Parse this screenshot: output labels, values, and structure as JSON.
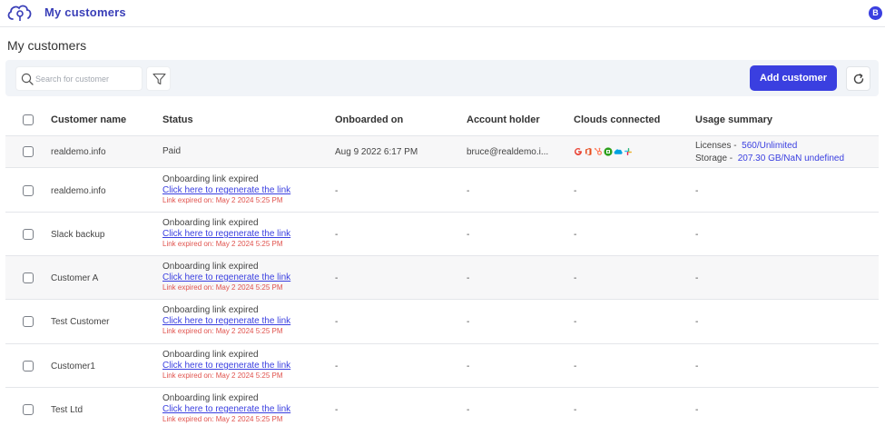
{
  "header": {
    "app_title": "My customers",
    "avatar_initial": "B"
  },
  "page_title": "My customers",
  "toolbar": {
    "search_placeholder": "Search for customer",
    "add_label": "Add customer"
  },
  "columns": [
    "Customer name",
    "Status",
    "Onboarded on",
    "Account holder",
    "Clouds connected",
    "Usage summary"
  ],
  "first_row": {
    "name": "realdemo.info",
    "status": "Paid",
    "onboarded_on": "Aug 9 2022 6:17 PM",
    "account_holder": "bruce@realdemo.i...",
    "clouds": [
      "google-icon",
      "office365-icon",
      "hubspot-icon",
      "quickbooks-icon",
      "salesforce-icon",
      "slack-icon"
    ],
    "licenses_label": "Licenses -",
    "licenses_value": "560/Unlimited",
    "storage_label": "Storage -",
    "storage_value": "207.30 GB/NaN undefined"
  },
  "pending_rows": [
    {
      "name": "realdemo.info",
      "status": "Onboarding link expired",
      "link": "Click here to regenerate the link",
      "expired": "Link expired on: May 2 2024 5:25 PM",
      "onboarded_on": "-",
      "account_holder": "-",
      "clouds": "-",
      "usage": "-"
    },
    {
      "name": "Slack backup",
      "status": "Onboarding link expired",
      "link": "Click here to regenerate the link",
      "expired": "Link expired on: May 2 2024 5:25 PM",
      "onboarded_on": "-",
      "account_holder": "-",
      "clouds": "-",
      "usage": "-"
    },
    {
      "name": "Customer A",
      "status": "Onboarding link expired",
      "link": "Click here to regenerate the link",
      "expired": "Link expired on: May 2 2024 5:25 PM",
      "onboarded_on": "-",
      "account_holder": "-",
      "clouds": "-",
      "usage": "-"
    },
    {
      "name": "Test Customer",
      "status": "Onboarding link expired",
      "link": "Click here to regenerate the link",
      "expired": "Link expired on: May 2 2024 5:25 PM",
      "onboarded_on": "-",
      "account_holder": "-",
      "clouds": "-",
      "usage": "-"
    },
    {
      "name": "Customer1",
      "status": "Onboarding link expired",
      "link": "Click here to regenerate the link",
      "expired": "Link expired on: May 2 2024 5:25 PM",
      "onboarded_on": "-",
      "account_holder": "-",
      "clouds": "-",
      "usage": "-"
    },
    {
      "name": "Test Ltd",
      "status": "Onboarding link expired",
      "link": "Click here to regenerate the link",
      "expired": "Link expired on: May 2 2024 5:25 PM",
      "onboarded_on": "-",
      "account_holder": "-",
      "clouds": "-",
      "usage": "-"
    }
  ],
  "colors": {
    "accent": "#3a3fe0",
    "expired_text": "#e0524d",
    "toolbar_bg": "#f1f4f8"
  }
}
